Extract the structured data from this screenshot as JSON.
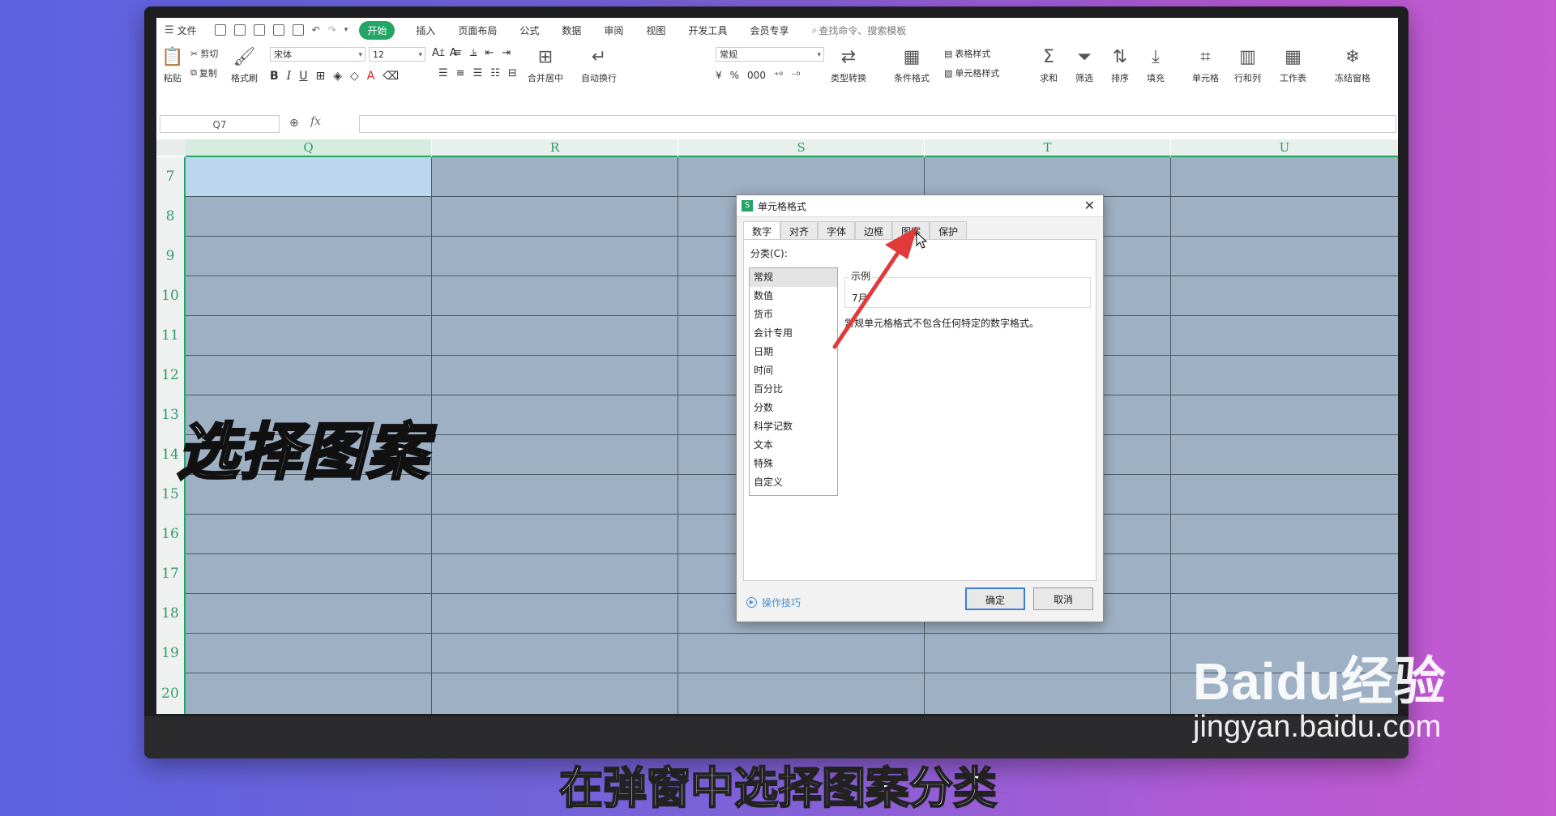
{
  "menu": {
    "file": "文件",
    "tabs": [
      "开始",
      "插入",
      "页面布局",
      "公式",
      "数据",
      "审阅",
      "视图",
      "开发工具",
      "会员专享"
    ],
    "search": "查找命令、搜索模板"
  },
  "ribbon": {
    "paste": "粘贴",
    "cut": "剪切",
    "copy": "复制",
    "format_painter": "格式刷",
    "font_name": "宋体",
    "font_size": "12",
    "merge_center": "合并居中",
    "wrap_text": "自动换行",
    "number_format": "常规",
    "type_convert": "类型转换",
    "conditional_format": "条件格式",
    "table_style": "表格样式",
    "cell_style": "单元格样式",
    "sum": "求和",
    "filter": "筛选",
    "sort": "排序",
    "fill": "填充",
    "cell": "单元格",
    "row_col": "行和列",
    "worksheet": "工作表",
    "freeze": "冻结窗格"
  },
  "formula_bar": {
    "name_box": "Q7",
    "fx": "fx"
  },
  "columns": [
    "Q",
    "R",
    "S",
    "T",
    "U"
  ],
  "rows": [
    "7",
    "8",
    "9",
    "10",
    "11",
    "12",
    "13",
    "14",
    "15",
    "16",
    "17",
    "18",
    "19",
    "20"
  ],
  "dialog": {
    "title": "单元格格式",
    "tabs": [
      "数字",
      "对齐",
      "字体",
      "边框",
      "图案",
      "保护"
    ],
    "category_label": "分类(C):",
    "categories": [
      "常规",
      "数值",
      "货币",
      "会计专用",
      "日期",
      "时间",
      "百分比",
      "分数",
      "科学记数",
      "文本",
      "特殊",
      "自定义"
    ],
    "sample_label": "示例",
    "sample_value": "7月",
    "description": "常规单元格格式不包含任何特定的数字格式。",
    "tips": "操作技巧",
    "ok": "确定",
    "cancel": "取消"
  },
  "overlay": {
    "caption": "选择图案",
    "subtitle": "在弹窗中选择图案分类",
    "watermark_brand": "Baidu经验",
    "watermark_url": "jingyan.baidu.com"
  }
}
